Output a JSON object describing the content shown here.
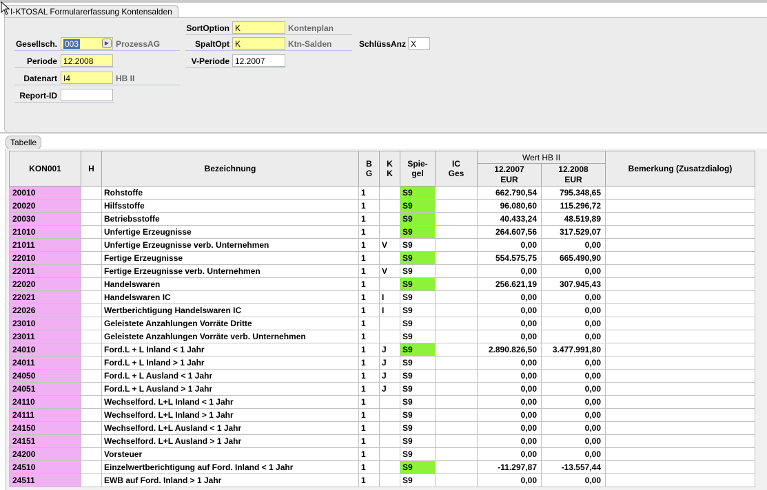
{
  "window": {
    "title": "I-KTOSAL Formularerfassung Kontensalden"
  },
  "form": {
    "gesellschaft": {
      "label": "Gesellsch.",
      "value": "003",
      "desc": "ProzessAG"
    },
    "periode": {
      "label": "Periode",
      "value": "12.2008"
    },
    "datenart": {
      "label": "Datenart",
      "value": "I4",
      "desc": "HB II"
    },
    "report_id": {
      "label": "Report-ID",
      "value": ""
    },
    "sortoption": {
      "label": "SortOption",
      "value": "K",
      "desc": "Kontenplan"
    },
    "spaltopt": {
      "label": "SpaltOpt",
      "value": "K",
      "desc": "Ktn-Salden"
    },
    "v_periode": {
      "label": "V-Periode",
      "value": "12.2007"
    },
    "schluessanz": {
      "label": "SchlüssAnz",
      "value": "X"
    }
  },
  "table": {
    "tab_label": "Tabelle",
    "headers": {
      "konto": "KON001",
      "h": "H",
      "bezeichnung": "Bezeichnung",
      "bg_1": "B",
      "bg_2": "G",
      "kk_1": "K",
      "kk_2": "K",
      "spiegel_1": "Spie-",
      "spiegel_2": "gel",
      "icges_1": "IC",
      "icges_2": "Ges",
      "wert_group": "Wert HB II",
      "p1_line1": "12.2007",
      "p1_line2": "EUR",
      "p2_line1": "12.2008",
      "p2_line2": "EUR",
      "bemerkung": "Bemerkung (Zusatzdialog)"
    },
    "colors": {
      "konto_bg": "#f0b0f3",
      "spiegel_highlight": "#8ef23b",
      "required_field": "#ffff9e"
    },
    "rows": [
      {
        "konto": "20010",
        "h": "",
        "bez": "Rohstoffe",
        "bg": "1",
        "kk": "",
        "spiegel": "S9",
        "hl": true,
        "ic": "",
        "v1": "662.790,54",
        "v2": "795.348,65",
        "bem": ""
      },
      {
        "konto": "20020",
        "h": "",
        "bez": "Hilfsstoffe",
        "bg": "1",
        "kk": "",
        "spiegel": "S9",
        "hl": true,
        "ic": "",
        "v1": "96.080,60",
        "v2": "115.296,72",
        "bem": ""
      },
      {
        "konto": "20030",
        "h": "",
        "bez": "Betriebsstoffe",
        "bg": "1",
        "kk": "",
        "spiegel": "S9",
        "hl": true,
        "ic": "",
        "v1": "40.433,24",
        "v2": "48.519,89",
        "bem": ""
      },
      {
        "konto": "21010",
        "h": "",
        "bez": "Unfertige Erzeugnisse",
        "bg": "1",
        "kk": "",
        "spiegel": "S9",
        "hl": true,
        "ic": "",
        "v1": "264.607,56",
        "v2": "317.529,07",
        "bem": ""
      },
      {
        "konto": "21011",
        "h": "",
        "bez": "Unfertige Erzeugnisse verb. Unternehmen",
        "bg": "1",
        "kk": "V",
        "spiegel": "S9",
        "hl": false,
        "ic": "",
        "v1": "0,00",
        "v2": "0,00",
        "bem": ""
      },
      {
        "konto": "22010",
        "h": "",
        "bez": "Fertige Erzeugnisse",
        "bg": "1",
        "kk": "",
        "spiegel": "S9",
        "hl": true,
        "ic": "",
        "v1": "554.575,75",
        "v2": "665.490,90",
        "bem": ""
      },
      {
        "konto": "22011",
        "h": "",
        "bez": "Fertige Erzeugnisse verb. Unternehmen",
        "bg": "1",
        "kk": "V",
        "spiegel": "S9",
        "hl": false,
        "ic": "",
        "v1": "0,00",
        "v2": "0,00",
        "bem": ""
      },
      {
        "konto": "22020",
        "h": "",
        "bez": "Handelswaren",
        "bg": "1",
        "kk": "",
        "spiegel": "S9",
        "hl": true,
        "ic": "",
        "v1": "256.621,19",
        "v2": "307.945,43",
        "bem": ""
      },
      {
        "konto": "22021",
        "h": "",
        "bez": "Handelswaren IC",
        "bg": "1",
        "kk": "I",
        "spiegel": "S9",
        "hl": false,
        "ic": "",
        "v1": "0,00",
        "v2": "0,00",
        "bem": ""
      },
      {
        "konto": "22026",
        "h": "",
        "bez": "Wertberichtigung Handelswaren IC",
        "bg": "1",
        "kk": "I",
        "spiegel": "S9",
        "hl": false,
        "ic": "",
        "v1": "0,00",
        "v2": "0,00",
        "bem": ""
      },
      {
        "konto": "23010",
        "h": "",
        "bez": "Geleistete Anzahlungen Vorräte Dritte",
        "bg": "1",
        "kk": "",
        "spiegel": "S9",
        "hl": false,
        "ic": "",
        "v1": "0,00",
        "v2": "0,00",
        "bem": ""
      },
      {
        "konto": "23011",
        "h": "",
        "bez": "Geleistete Anzahlungen Vorräte verb. Unternehmen",
        "bg": "1",
        "kk": "",
        "spiegel": "S9",
        "hl": false,
        "ic": "",
        "v1": "0,00",
        "v2": "0,00",
        "bem": ""
      },
      {
        "konto": "24010",
        "h": "",
        "bez": "Ford.L + L Inland < 1 Jahr",
        "bg": "1",
        "kk": "J",
        "spiegel": "S9",
        "hl": true,
        "ic": "",
        "v1": "2.890.826,50",
        "v2": "3.477.991,80",
        "bem": ""
      },
      {
        "konto": "24011",
        "h": "",
        "bez": "Ford.L + L Inland > 1 Jahr",
        "bg": "1",
        "kk": "J",
        "spiegel": "S9",
        "hl": false,
        "ic": "",
        "v1": "0,00",
        "v2": "0,00",
        "bem": ""
      },
      {
        "konto": "24050",
        "h": "",
        "bez": "Ford.L + L Ausland < 1 Jahr",
        "bg": "1",
        "kk": "J",
        "spiegel": "S9",
        "hl": false,
        "ic": "",
        "v1": "0,00",
        "v2": "0,00",
        "bem": ""
      },
      {
        "konto": "24051",
        "h": "",
        "bez": "Ford.L + L Ausland > 1 Jahr",
        "bg": "1",
        "kk": "J",
        "spiegel": "S9",
        "hl": false,
        "ic": "",
        "v1": "0,00",
        "v2": "0,00",
        "bem": ""
      },
      {
        "konto": "24110",
        "h": "",
        "bez": "Wechselford. L+L Inland < 1 Jahr",
        "bg": "1",
        "kk": "",
        "spiegel": "S9",
        "hl": false,
        "ic": "",
        "v1": "0,00",
        "v2": "0,00",
        "bem": ""
      },
      {
        "konto": "24111",
        "h": "",
        "bez": "Wechselford. L+L Inland > 1 Jahr",
        "bg": "1",
        "kk": "",
        "spiegel": "S9",
        "hl": false,
        "ic": "",
        "v1": "0,00",
        "v2": "0,00",
        "bem": ""
      },
      {
        "konto": "24150",
        "h": "",
        "bez": "Wechselford. L+L Ausland < 1 Jahr",
        "bg": "1",
        "kk": "",
        "spiegel": "S9",
        "hl": false,
        "ic": "",
        "v1": "0,00",
        "v2": "0,00",
        "bem": ""
      },
      {
        "konto": "24151",
        "h": "",
        "bez": "Wechselford. L+L Ausland > 1 Jahr",
        "bg": "1",
        "kk": "",
        "spiegel": "S9",
        "hl": false,
        "ic": "",
        "v1": "0,00",
        "v2": "0,00",
        "bem": ""
      },
      {
        "konto": "24200",
        "h": "",
        "bez": "Vorsteuer",
        "bg": "1",
        "kk": "",
        "spiegel": "S9",
        "hl": false,
        "ic": "",
        "v1": "0,00",
        "v2": "0,00",
        "bem": ""
      },
      {
        "konto": "24510",
        "h": "",
        "bez": "Einzelwertberichtigung auf Ford. Inland < 1 Jahr",
        "bg": "1",
        "kk": "",
        "spiegel": "S9",
        "hl": true,
        "ic": "",
        "v1": "-11.297,87",
        "v2": "-13.557,44",
        "bem": ""
      },
      {
        "konto": "24511",
        "h": "",
        "bez": "EWB auf Ford. Inland > 1 Jahr",
        "bg": "1",
        "kk": "",
        "spiegel": "S9",
        "hl": false,
        "ic": "",
        "v1": "0,00",
        "v2": "0,00",
        "bem": ""
      }
    ]
  }
}
